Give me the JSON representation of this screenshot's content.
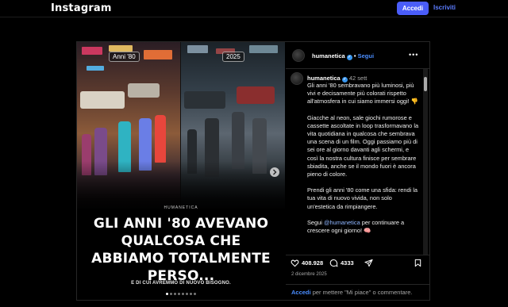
{
  "topbar": {
    "logo": "Instagram",
    "login_label": "Accedi",
    "signup_label": "Iscriviti"
  },
  "media": {
    "badge_left": "Anni '80",
    "badge_right": "2025",
    "brand": "HUMANETICA",
    "headline": "GLI ANNI '80 AVEVANO QUALCOSA CHE ABBIAMO TOTALMENTE PERSO...",
    "subline": "E DI CUI AVREMMO DI NUOVO BISOGNO.",
    "next_icon": "chevron-right-icon",
    "dots": [
      true,
      false,
      false,
      false,
      false,
      false,
      false,
      false
    ]
  },
  "post_header": {
    "username": "humanetica",
    "separator": "•",
    "follow_label": "Segui",
    "more_icon": "more-horizontal-icon"
  },
  "caption": {
    "username": "humanetica",
    "date": "42 sett",
    "p1": "Gli anni '80 sembravano più luminosi, più vivi e decisamente più colorati rispetto all'atmosfera in cui siamo immersi oggi! 👎",
    "p2": "Giacche al neon, sale giochi rumorose e cassette ascoltate in loop trasformavano la vita quotidiana in qualcosa che sembrava una scena di un film. Oggi passiamo più di sei ore al giorno davanti agli schermi, e così la nostra cultura finisce per sembrare sbiadita, anche se il mondo fuori è ancora pieno di colore.",
    "p3": "Prendi gli anni '80 come una sfida: rendi la tua vita di nuovo vivida, non solo un'estetica da rimpiangere.",
    "p4_pre": "Segui ",
    "p4_mention": "@humanetica",
    "p4_post": " per continuare a crescere ogni giorno! 🧠"
  },
  "actions": {
    "likes": "408.928",
    "comments": "4333",
    "post_date": "2 dicembre 2025"
  },
  "comment_prompt": {
    "cta": "Accedi",
    "rest": " per mettere \"Mi piace\" o commentare."
  },
  "colors": {
    "accent": "#4a5df9",
    "link": "#4a8dff",
    "background": "#000000"
  }
}
